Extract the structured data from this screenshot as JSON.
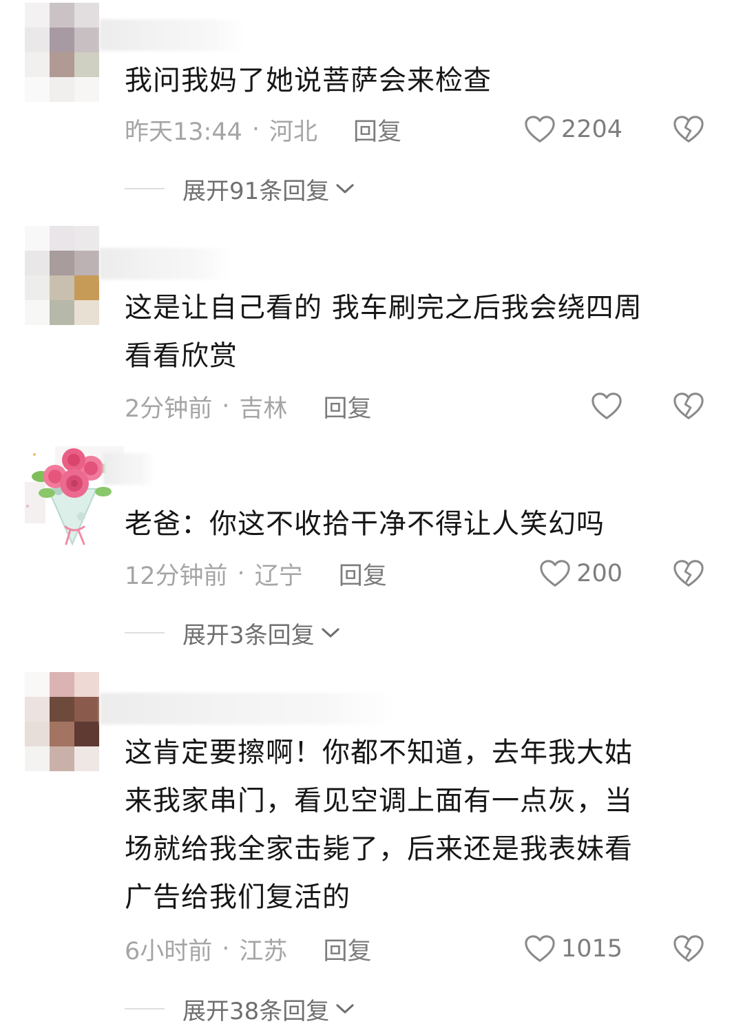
{
  "comments": [
    {
      "text": "我问我妈了她说菩萨会来检查",
      "time": "昨天13:44",
      "location": "河北",
      "reply_label": "回复",
      "likes": "2204",
      "expand_label": "展开91条回复"
    },
    {
      "text": "这是让自己看的 我车刷完之后我会绕四周\n看看欣赏",
      "time": "2分钟前",
      "location": "吉林",
      "reply_label": "回复",
      "likes": ""
    },
    {
      "text": "老爸：你这不收拾干净不得让人笑幻吗",
      "time": "12分钟前",
      "location": "辽宁",
      "reply_label": "回复",
      "likes": "200",
      "expand_label": "展开3条回复"
    },
    {
      "text": "这肯定要擦啊！你都不知道，去年我大姑\n来我家串门，看见空调上面有一点灰，当\n场就给我全家击毙了，后来还是我表妹看\n广告给我们复活的",
      "time": "6小时前",
      "location": "江苏",
      "reply_label": "回复",
      "likes": "1015",
      "expand_label": "展开38条回复"
    }
  ],
  "icons": {
    "like": "heart-outline-icon",
    "dislike": "broken-heart-icon",
    "expand": "chevron-down-icon"
  },
  "colors": {
    "text": "#161616",
    "meta": "#a5a5a5",
    "action": "#7c7c7c",
    "icon": "#8a8a8a"
  }
}
